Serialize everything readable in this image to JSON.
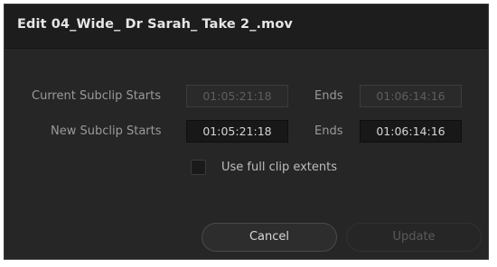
{
  "dialog": {
    "title": "Edit 04_Wide_ Dr Sarah_ Take 2_.mov"
  },
  "current_subclip": {
    "label": "Current Subclip Starts",
    "start": "01:05:21:18",
    "ends_label": "Ends",
    "end": "01:06:14:16"
  },
  "new_subclip": {
    "label": "New Subclip Starts",
    "start": "01:05:21:18",
    "ends_label": "Ends",
    "end": "01:06:14:16"
  },
  "use_full_clip": {
    "label": "Use full clip extents",
    "checked": false
  },
  "buttons": {
    "cancel": "Cancel",
    "update": "Update"
  }
}
